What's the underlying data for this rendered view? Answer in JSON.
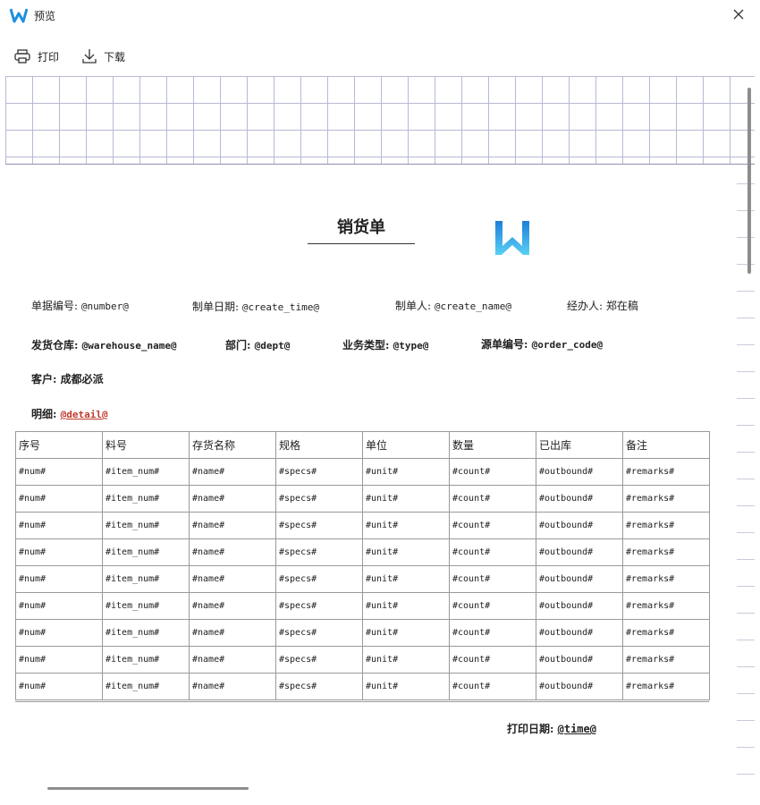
{
  "window": {
    "title": "预览"
  },
  "toolbar": {
    "print_label": "打印",
    "download_label": "下载"
  },
  "document": {
    "title": "销货单",
    "fields": {
      "number_label": "单据编号:",
      "number_value": "@number@",
      "create_time_label": "制单日期:",
      "create_time_value": "@create_time@",
      "create_name_label": "制单人:",
      "create_name_value": "@create_name@",
      "handler_label": "经办人:",
      "handler_value": "郑在稿",
      "warehouse_label": "发货仓库:",
      "warehouse_value": "@warehouse_name@",
      "dept_label": "部门:",
      "dept_value": "@dept@",
      "type_label": "业务类型:",
      "type_value": "@type@",
      "order_code_label": "源单编号:",
      "order_code_value": "@order_code@",
      "customer_label": "客户:",
      "customer_value": "成都必派",
      "detail_label": "明细:",
      "detail_value": "@detail@"
    },
    "table": {
      "headers": [
        "序号",
        "料号",
        "存货名称",
        "规格",
        "单位",
        "数量",
        "已出库",
        "备注"
      ],
      "rows": [
        [
          "#num#",
          "#item_num#",
          "#name#",
          "#specs#",
          "#unit#",
          "#count#",
          "#outbound#",
          "#remarks#"
        ],
        [
          "#num#",
          "#item_num#",
          "#name#",
          "#specs#",
          "#unit#",
          "#count#",
          "#outbound#",
          "#remarks#"
        ],
        [
          "#num#",
          "#item_num#",
          "#name#",
          "#specs#",
          "#unit#",
          "#count#",
          "#outbound#",
          "#remarks#"
        ],
        [
          "#num#",
          "#item_num#",
          "#name#",
          "#specs#",
          "#unit#",
          "#count#",
          "#outbound#",
          "#remarks#"
        ],
        [
          "#num#",
          "#item_num#",
          "#name#",
          "#specs#",
          "#unit#",
          "#count#",
          "#outbound#",
          "#remarks#"
        ],
        [
          "#num#",
          "#item_num#",
          "#name#",
          "#specs#",
          "#unit#",
          "#count#",
          "#outbound#",
          "#remarks#"
        ],
        [
          "#num#",
          "#item_num#",
          "#name#",
          "#specs#",
          "#unit#",
          "#count#",
          "#outbound#",
          "#remarks#"
        ],
        [
          "#num#",
          "#item_num#",
          "#name#",
          "#specs#",
          "#unit#",
          "#count#",
          "#outbound#",
          "#remarks#"
        ],
        [
          "#num#",
          "#item_num#",
          "#name#",
          "#specs#",
          "#unit#",
          "#count#",
          "#outbound#",
          "#remarks#"
        ]
      ]
    },
    "footer": {
      "print_date_label": "打印日期:",
      "print_date_value": "@time@"
    }
  },
  "icons": {
    "app": "w-logo-icon",
    "close": "close-icon",
    "print": "printer-icon",
    "download": "download-icon"
  },
  "colors": {
    "brand_blue": "#1e90e0",
    "brand_cyan": "#4fc3f7",
    "detail_red": "#c0392b",
    "grid_line": "#b7b9d4"
  }
}
